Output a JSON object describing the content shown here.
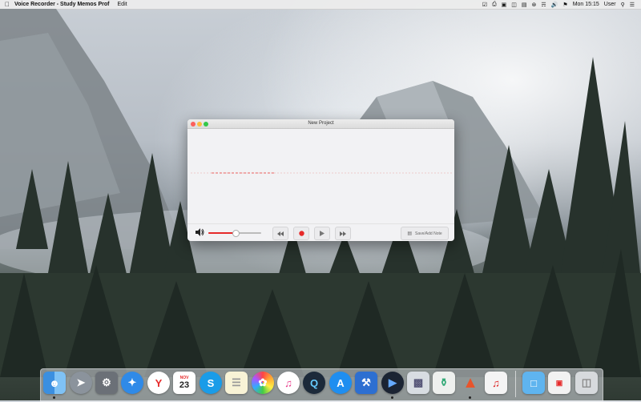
{
  "menubar": {
    "app_name": "Voice Recorder - Study Memos Prof",
    "menus": [
      "Edit"
    ],
    "language": "U.S.",
    "clock": "Mon 15:15",
    "user": "User"
  },
  "window": {
    "title": "New Project",
    "volume_level": 0.5,
    "save_label": "Save/Add Note"
  },
  "dock": {
    "apps": [
      {
        "name": "Finder",
        "icon": "finder-icon"
      },
      {
        "name": "Launchpad",
        "icon": "launchpad-icon"
      },
      {
        "name": "System Preferences",
        "icon": "gear-icon"
      },
      {
        "name": "Safari",
        "icon": "compass-icon"
      },
      {
        "name": "Yandex",
        "icon": "yandex-icon"
      },
      {
        "name": "Calendar",
        "icon": "calendar-icon",
        "month": "NOV",
        "day": "23"
      },
      {
        "name": "Skype",
        "icon": "skype-icon"
      },
      {
        "name": "Notes",
        "icon": "notes-icon"
      },
      {
        "name": "Photos",
        "icon": "photos-icon"
      },
      {
        "name": "iTunes",
        "icon": "music-note-icon"
      },
      {
        "name": "QuickTime",
        "icon": "quicktime-icon"
      },
      {
        "name": "App Store",
        "icon": "app-store-icon"
      },
      {
        "name": "Xcode",
        "icon": "xcode-icon"
      },
      {
        "name": "Voice Recorder",
        "icon": "voice-recorder-icon"
      },
      {
        "name": "Preview",
        "icon": "preview-icon"
      },
      {
        "name": "Vase",
        "icon": "vase-icon"
      },
      {
        "name": "Sketch",
        "icon": "sketch-icon"
      },
      {
        "name": "Music Maker",
        "icon": "music-file-icon"
      },
      {
        "name": "Folder",
        "icon": "folder-icon"
      },
      {
        "name": "Yandex Browser",
        "icon": "browser-window-icon"
      },
      {
        "name": "Trash",
        "icon": "trash-icon"
      }
    ]
  },
  "colors": {
    "accent_red": "#e62a2a",
    "window_bg": "#f2f2f4"
  }
}
